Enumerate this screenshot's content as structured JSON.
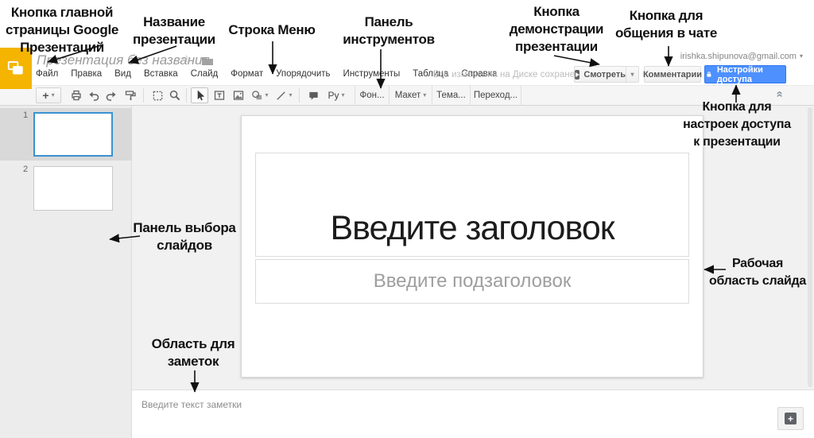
{
  "annotations": {
    "home": "Кнопка главной\nстраницы Google\nПрезентаций",
    "doc_title": "Название\nпрезентации",
    "menu_bar": "Строка Меню",
    "toolbar": "Панель\nинструментов",
    "present": "Кнопка\nдемонстрации\nпрезентации",
    "chat": "Кнопка для\nобщения в чате",
    "share": "Кнопка для\nнастроек доступа\nк презентации",
    "filmstrip": "Панель выбора\nслайдов",
    "notes": "Область для\nзаметок",
    "work_area": "Рабочая\nобласть слайда"
  },
  "header": {
    "doc_title": "Презентация без названия",
    "menu": [
      "Файл",
      "Правка",
      "Вид",
      "Вставка",
      "Слайд",
      "Формат",
      "Упорядочить",
      "Инструменты",
      "Таблица",
      "Справка"
    ],
    "status": "Все изменения на Диске сохранены",
    "present_button": "Смотреть",
    "comments_button": "Комментарии",
    "share_button": "Настройки доступа",
    "account_email": "irishka.shipunova@gmail.com"
  },
  "toolbar": {
    "input_tools": "Ру",
    "background_button": "Фон...",
    "layout_button": "Макет",
    "theme_button": "Тема...",
    "transition_button": "Переход..."
  },
  "filmstrip": {
    "slides": [
      {
        "number": "1"
      },
      {
        "number": "2"
      }
    ]
  },
  "slide": {
    "title_placeholder": "Введите заголовок",
    "subtitle_placeholder": "Введите подзаголовок"
  },
  "notes": {
    "placeholder": "Введите текст заметки"
  },
  "icons": {
    "star": "☆",
    "caret": "▾",
    "collapse": "»",
    "plus": "+"
  },
  "colors": {
    "accent_blue": "#4d90fe",
    "logo_yellow": "#f4b400",
    "selection_blue": "#3b92d2"
  }
}
